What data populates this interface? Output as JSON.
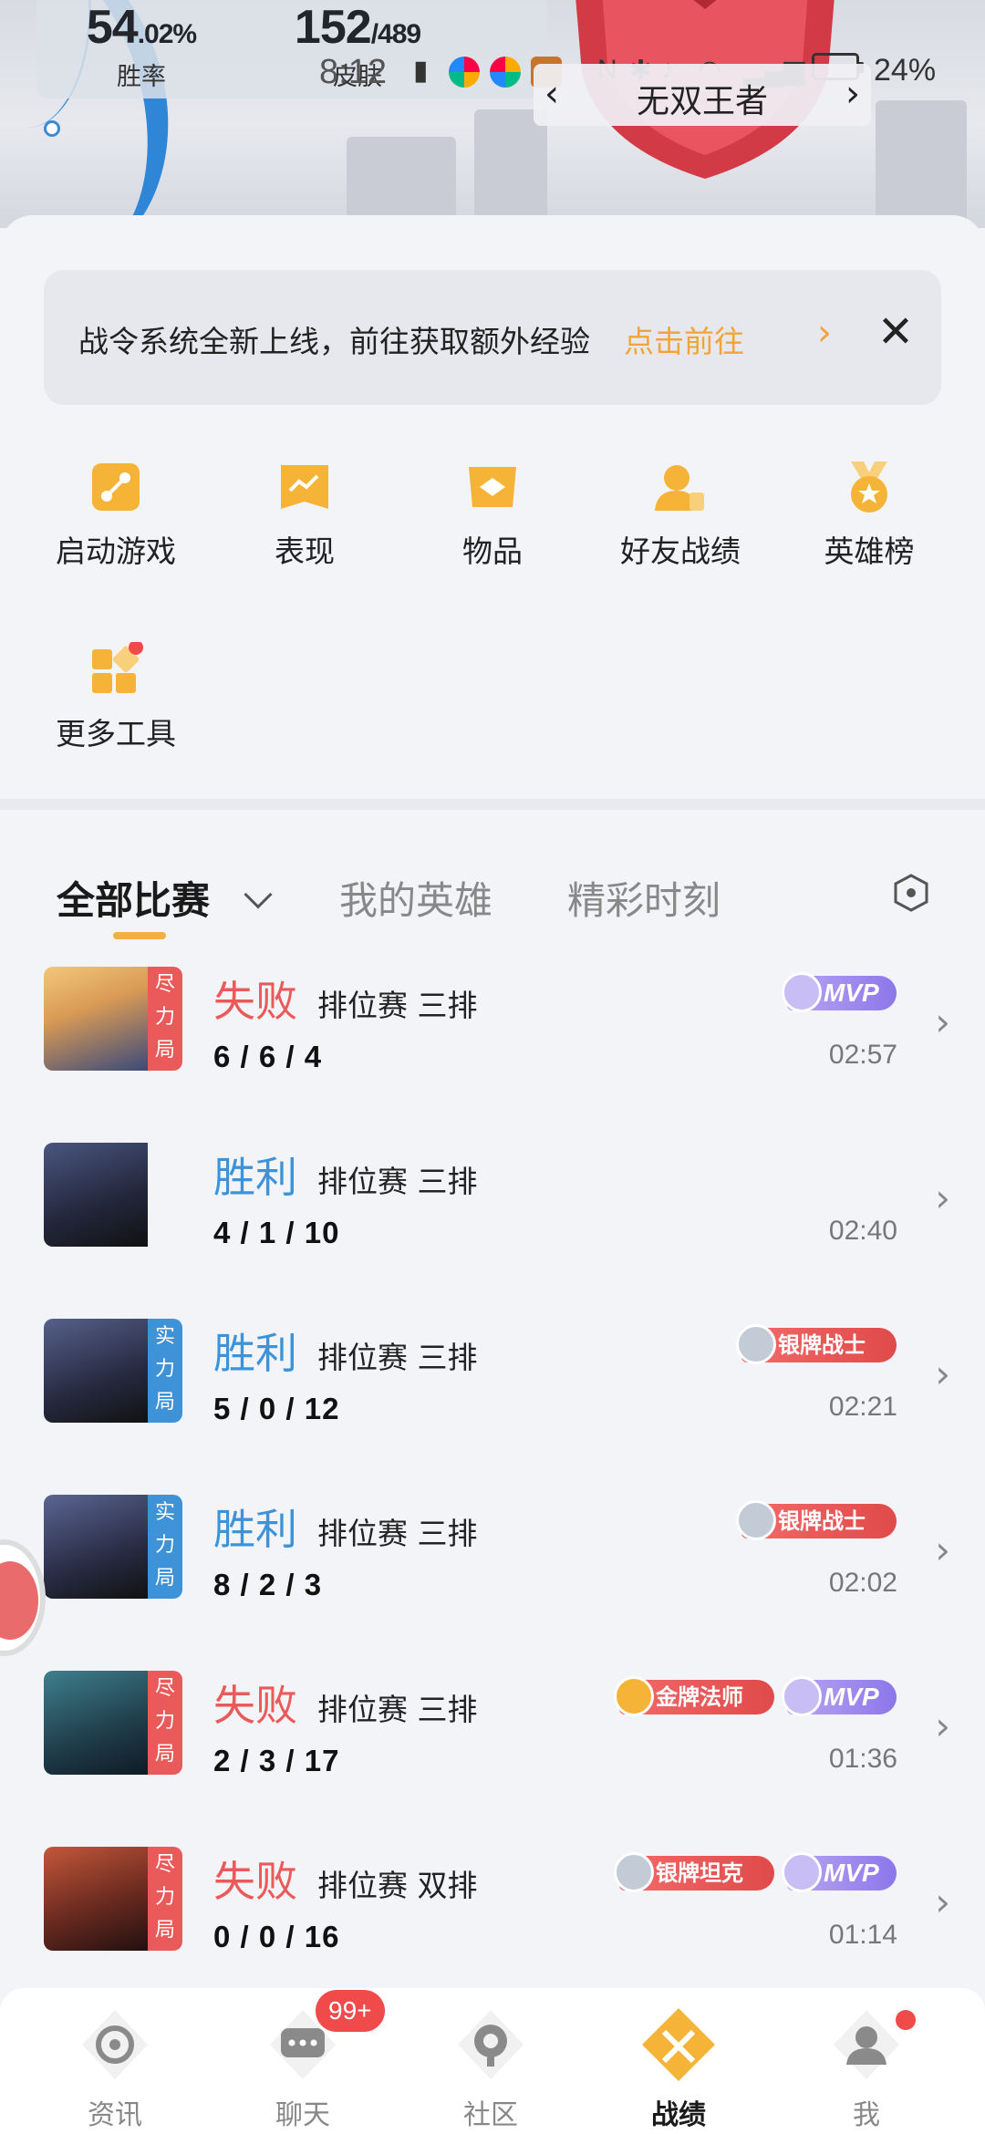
{
  "header": {
    "stats": [
      {
        "value": "54",
        "suffix": ".02%",
        "label": "胜率"
      },
      {
        "value": "152",
        "suffix": "/489",
        "label": "皮肤"
      }
    ],
    "rank_title": "无双王者",
    "prev_icon": "chevron-left-icon",
    "next_icon": "chevron-right-icon"
  },
  "status_bar": {
    "time": "8:12",
    "battery_percent": "24%"
  },
  "notice": {
    "message": "战令系统全新上线，前往获取额外经验",
    "action": "点击前往",
    "close_icon": "close-icon"
  },
  "tools": [
    {
      "label": "启动游戏",
      "icon": "launch-game-icon"
    },
    {
      "label": "表现",
      "icon": "performance-chart-icon"
    },
    {
      "label": "物品",
      "icon": "items-icon"
    },
    {
      "label": "好友战绩",
      "icon": "friends-record-icon"
    },
    {
      "label": "英雄榜",
      "icon": "hero-ranking-medal-icon"
    },
    {
      "label": "更多工具",
      "icon": "more-tools-icon",
      "has_dot": true
    }
  ],
  "tabs": [
    {
      "label": "全部比赛",
      "active": true
    },
    {
      "label": "我的英雄",
      "active": false
    },
    {
      "label": "精彩时刻",
      "active": false
    }
  ],
  "matches": [
    {
      "result": "失败",
      "outcome": "lose",
      "mode": "排位赛 三排",
      "kda": "6 / 6 / 4",
      "time": "02:57",
      "tag": "尽力局",
      "tag_color": "#ea5a5a",
      "badges": [
        {
          "type": "mvp",
          "text": "MVP"
        }
      ]
    },
    {
      "result": "胜利",
      "outcome": "win",
      "mode": "排位赛 三排",
      "kda": "4 / 1 / 10",
      "time": "02:40",
      "tag": "",
      "tag_color": "",
      "badges": []
    },
    {
      "result": "胜利",
      "outcome": "win",
      "mode": "排位赛 三排",
      "kda": "5 / 0 / 12",
      "time": "02:21",
      "tag": "实力局",
      "tag_color": "#3e93d8",
      "badges": [
        {
          "type": "red",
          "text": "银牌战士"
        }
      ]
    },
    {
      "result": "胜利",
      "outcome": "win",
      "mode": "排位赛 三排",
      "kda": "8 / 2 / 3",
      "time": "02:02",
      "tag": "实力局",
      "tag_color": "#3e93d8",
      "badges": [
        {
          "type": "red",
          "text": "银牌战士"
        }
      ]
    },
    {
      "result": "失败",
      "outcome": "lose",
      "mode": "排位赛 三排",
      "kda": "2 / 3 / 17",
      "time": "01:36",
      "tag": "尽力局",
      "tag_color": "#ea5a5a",
      "badges": [
        {
          "type": "red",
          "text": "金牌法师"
        },
        {
          "type": "mvp",
          "text": "MVP"
        }
      ]
    },
    {
      "result": "失败",
      "outcome": "lose",
      "mode": "排位赛 双排",
      "kda": "0 / 0 / 16",
      "time": "01:14",
      "tag": "尽力局",
      "tag_color": "#ea5a5a",
      "badges": [
        {
          "type": "red",
          "text": "银牌坦克"
        },
        {
          "type": "mvp",
          "text": "MVP"
        }
      ]
    }
  ],
  "nav": [
    {
      "label": "资讯",
      "icon": "news-icon",
      "active": false,
      "badge": ""
    },
    {
      "label": "聊天",
      "icon": "chat-icon",
      "active": false,
      "badge": "99+"
    },
    {
      "label": "社区",
      "icon": "community-icon",
      "active": false,
      "badge": ""
    },
    {
      "label": "战绩",
      "icon": "battle-record-icon",
      "active": true,
      "badge": ""
    },
    {
      "label": "我",
      "icon": "profile-icon",
      "active": false,
      "badge": "dot"
    }
  ],
  "colors": {
    "accent_orange": "#f0a43a",
    "win_blue": "#3e93d8",
    "lose_red": "#ea5a5a",
    "mvp_purple": "#8c77ea"
  }
}
